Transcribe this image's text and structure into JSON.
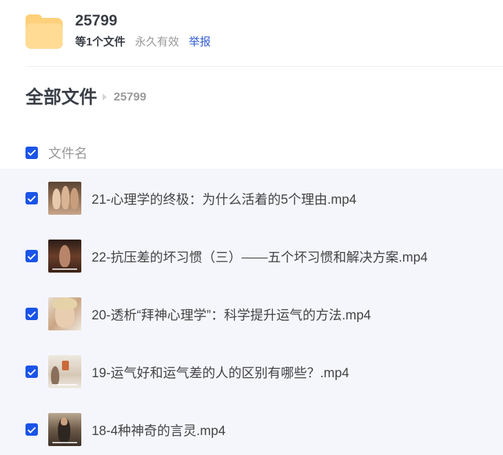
{
  "share": {
    "title": "25799",
    "file_count": "等1个文件",
    "validity": "永久有效",
    "report": "举报"
  },
  "breadcrumb": {
    "root": "全部文件",
    "current": "25799"
  },
  "list": {
    "header": "文件名",
    "files": [
      {
        "name": "21-心理学的终极：为什么活着的5个理由.mp4",
        "checked": true
      },
      {
        "name": "22-抗压差的坏习惯（三）——五个坏习惯和解决方案.mp4",
        "checked": true
      },
      {
        "name": "20-透析“拜神心理学”：科学提升运气的方法.mp4",
        "checked": true
      },
      {
        "name": "19-运气好和运气差的人的区别有哪些？.mp4",
        "checked": true
      },
      {
        "name": "18-4种神奇的言灵.mp4",
        "checked": true
      }
    ]
  },
  "icons": {
    "folder": "folder-icon",
    "checkbox": "checkbox-checked-icon",
    "thumbnail": "video-thumbnail"
  },
  "colors": {
    "accent": "#1a54e8",
    "link": "#2f5bd6",
    "folder": "#ffd17c",
    "list_background": "#f5f6fc"
  }
}
